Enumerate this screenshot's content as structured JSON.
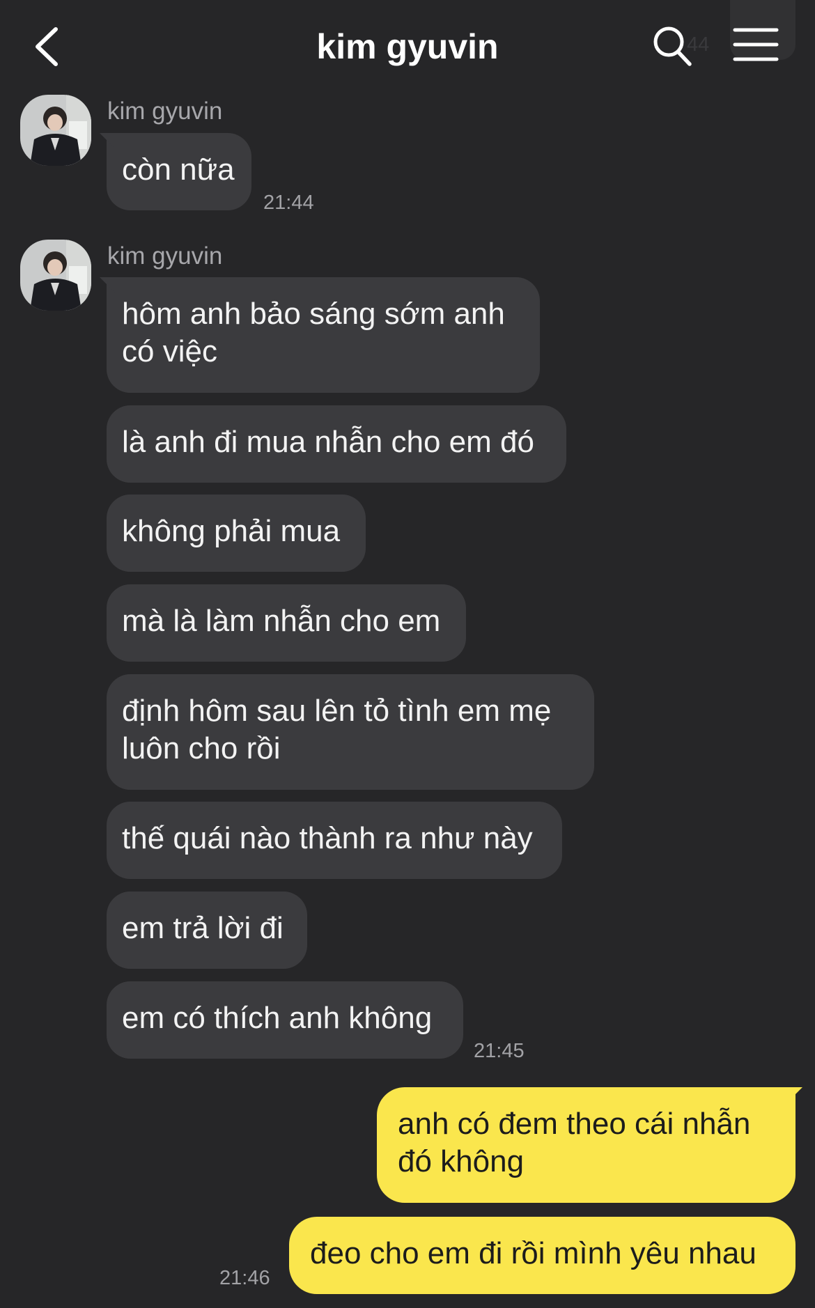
{
  "header": {
    "title": "kim gyuvin",
    "back_icon": "chevron-left-icon",
    "search_icon": "search-icon",
    "menu_icon": "hamburger-menu-icon",
    "partial_time": "44"
  },
  "colors": {
    "background": "#262628",
    "incoming_bubble": "#3b3b3e",
    "outgoing_bubble": "#fae64d",
    "timestamp": "#a2a2a6"
  },
  "messages": {
    "group1": {
      "sender": "kim gyuvin",
      "bubbles": [
        "còn nữa"
      ],
      "time": "21:44"
    },
    "group2": {
      "sender": "kim gyuvin",
      "bubbles": [
        "hôm anh bảo sáng sớm anh có việc",
        "là anh đi mua nhẫn cho em đó",
        "không phải mua",
        "mà là làm nhẫn cho em",
        "định hôm sau lên tỏ tình em mẹ luôn cho rồi",
        "thế quái nào thành ra như này",
        "em trả lời đi",
        "em có thích anh không"
      ],
      "time": "21:45"
    },
    "group3": {
      "bubbles": [
        "anh có đem theo cái nhẫn đó không",
        "đeo cho em đi rồi mình yêu nhau"
      ],
      "time": "21:46"
    }
  }
}
